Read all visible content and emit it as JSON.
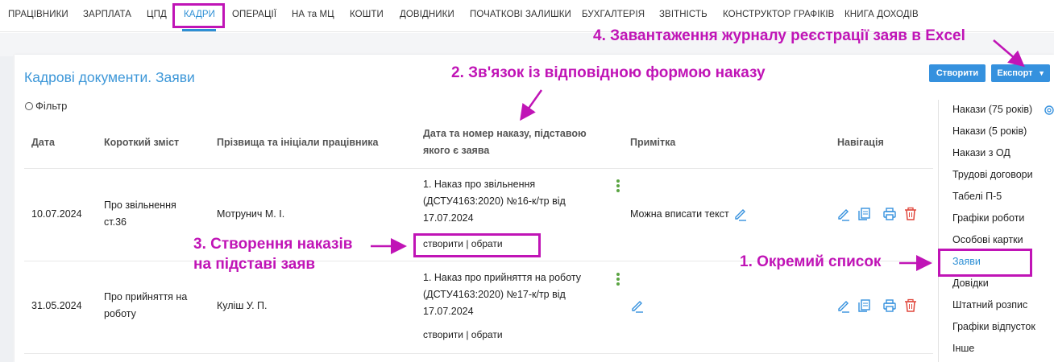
{
  "topnav": {
    "items": [
      "ПРАЦІВНИКИ",
      "ЗАРПЛАТА",
      "ЦПД",
      "КАДРИ",
      "ОПЕРАЦІЇ",
      "НА та МЦ",
      "КОШТИ",
      "ДОВІДНИКИ",
      "ПОЧАТКОВІ ЗАЛИШКИ",
      "БУХГАЛТЕРІЯ",
      "ЗВІТНІСТЬ",
      "КОНСТРУКТОР ГРАФІКІВ",
      "КНИГА ДОХОДІВ"
    ],
    "active": "КАДРИ"
  },
  "page": {
    "title": "Кадрові документи. Заяви",
    "create_label": "Створити",
    "export_label": "Експорт",
    "filter_label": "Фільтр"
  },
  "table": {
    "headers": {
      "date": "Дата",
      "summary": "Короткий зміст",
      "employee": "Прізвища та ініціали працівника",
      "order_l1": "Дата та номер наказу, підставою",
      "order_l2": "якого є заява",
      "note": "Примітка",
      "nav": "Навігація"
    },
    "rows": [
      {
        "date": "10.07.2024",
        "summary_l1": "Про звільнення",
        "summary_l2": "ст.36",
        "employee": "Мотрунич М. І.",
        "order_l1": "1. Наказ про звільнення",
        "order_l2": "(ДСТУ4163:2020) №16-к/тр від",
        "order_l3": "17.07.2024",
        "actions": "створити | обрати",
        "note": "Можна вписати текст"
      },
      {
        "date": "31.05.2024",
        "summary_l1": "Про прийняття на",
        "summary_l2": "роботу",
        "employee": "Куліш У. П.",
        "order_l1": "1. Наказ про прийняття на роботу",
        "order_l2": "(ДСТУ4163:2020) №17-к/тр від",
        "order_l3": "17.07.2024",
        "actions": "створити | обрати",
        "note": ""
      }
    ]
  },
  "sidebar": {
    "items": [
      "Накази (75 років)",
      "Накази (5 років)",
      "Накази з ОД",
      "Трудові договори",
      "Табелі П-5",
      "Графіки роботи",
      "Особові картки",
      "Заяви",
      "Довідки",
      "Штатний розпис",
      "Графіки відпусток",
      "Інше"
    ],
    "active": "Заяви"
  },
  "annotations": {
    "a1": "1. Окремий список",
    "a2": "2. Зв'язок із відповідною формою наказу",
    "a3_l1": "3. Створення наказів",
    "a3_l2": "на підставі заяв",
    "a4": "4. Завантаження журналу реєстрації заяв в Excel"
  },
  "colors": {
    "accent": "#2d8fd5",
    "annotation": "#c014b6",
    "delete": "#e0453a",
    "kebab": "#5aa442"
  }
}
